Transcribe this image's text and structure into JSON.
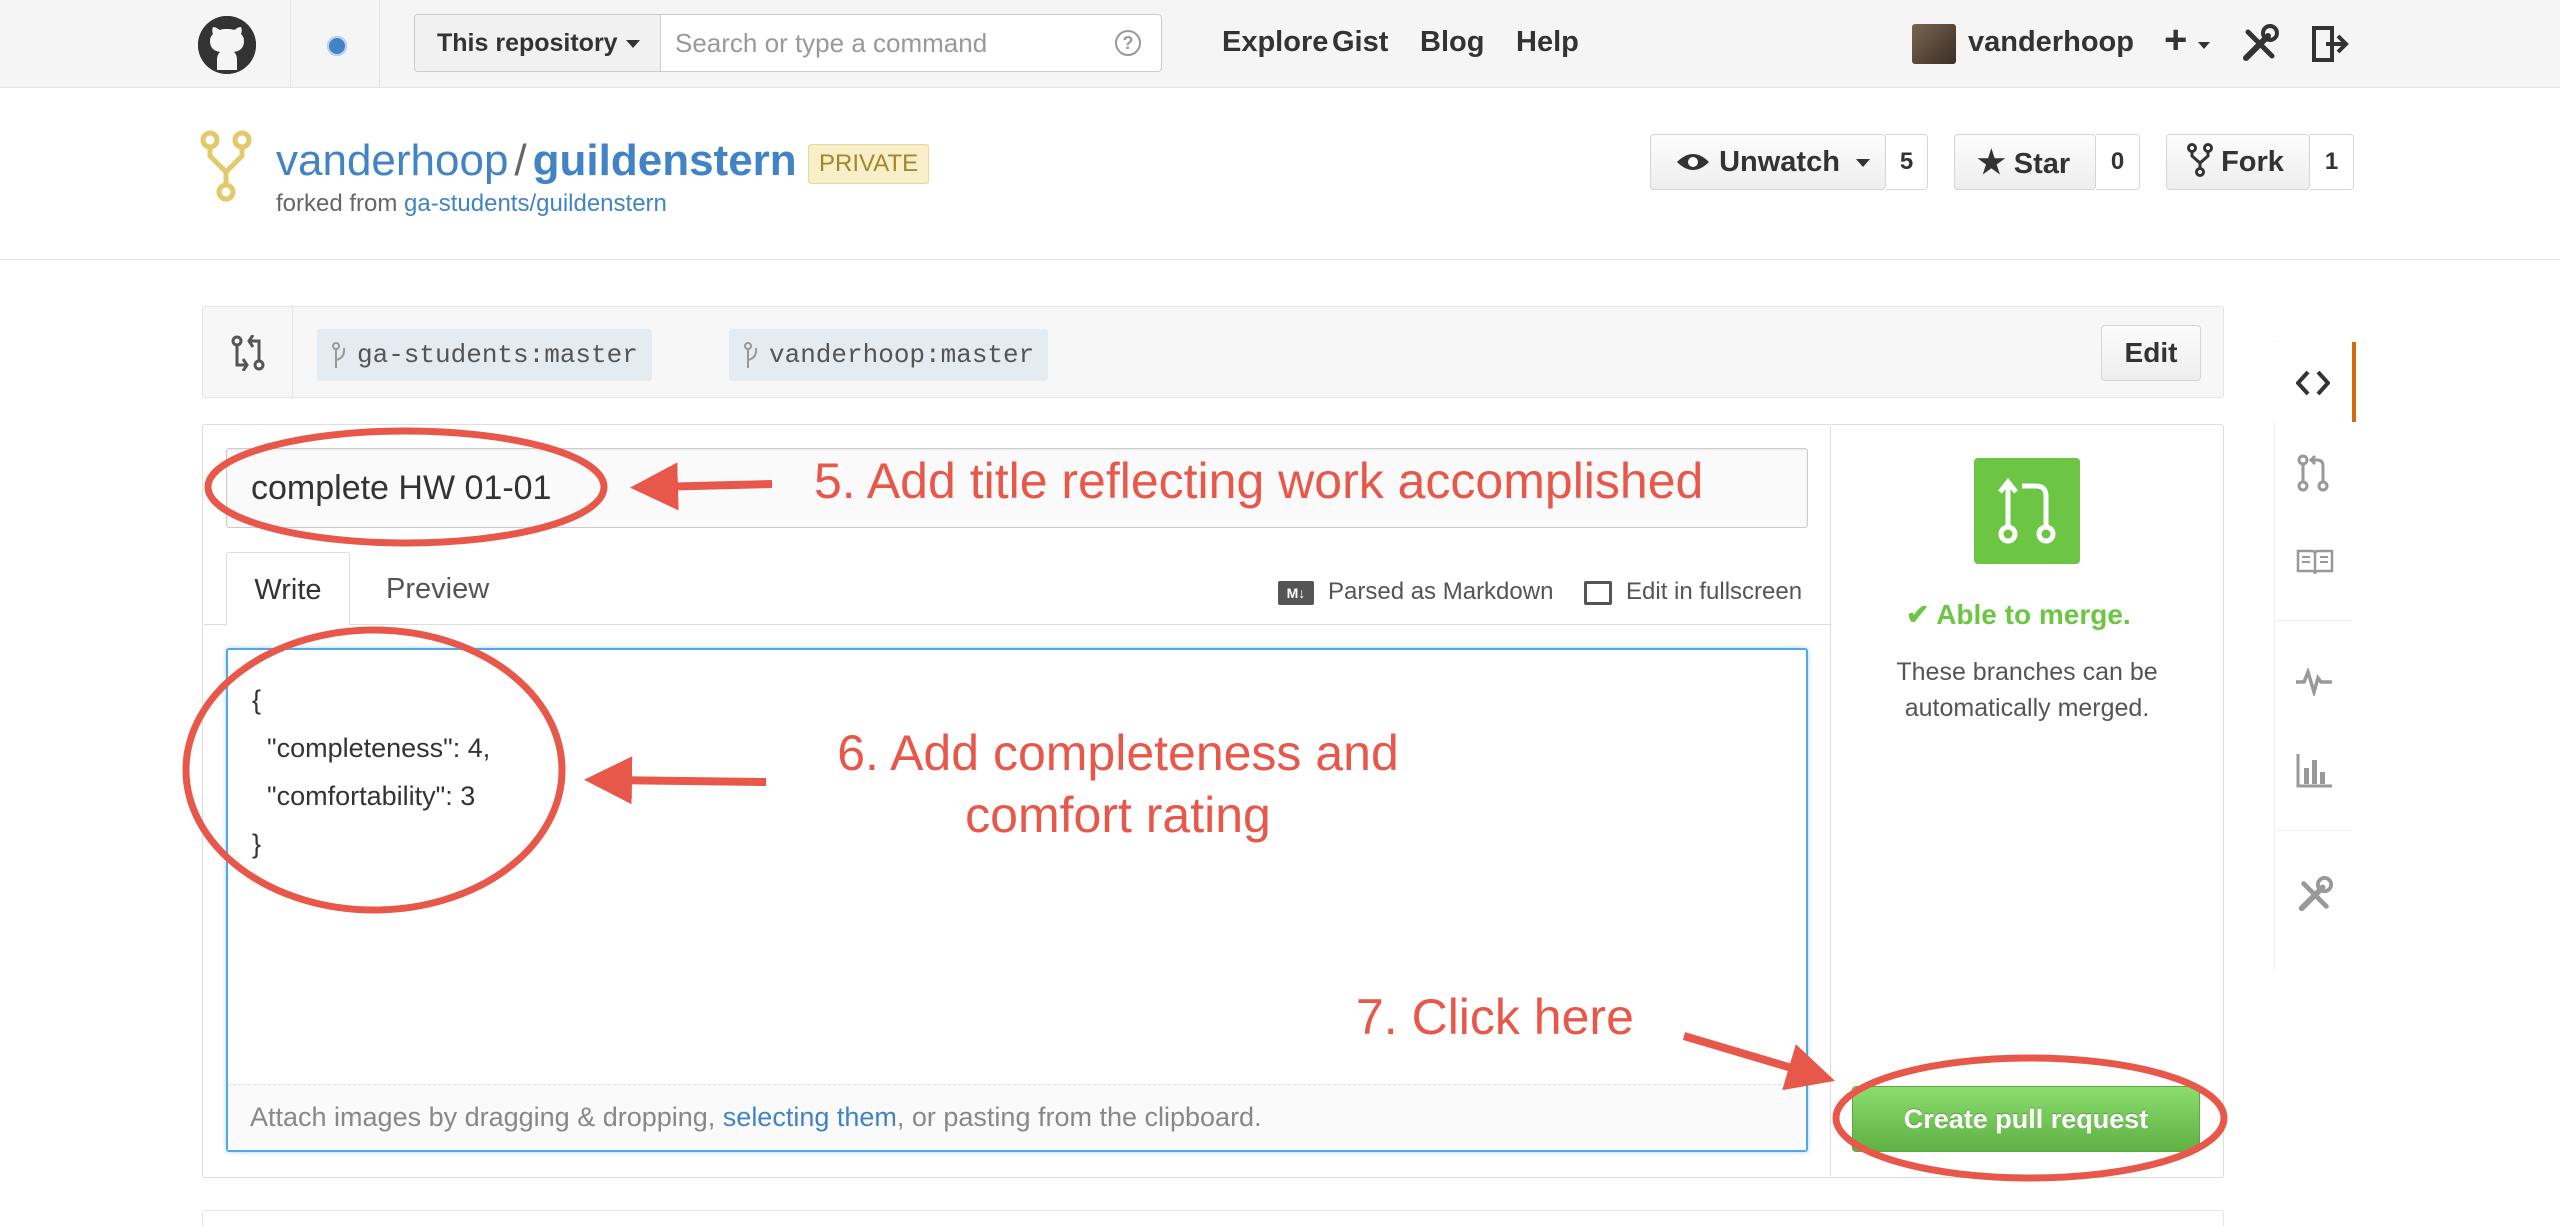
{
  "header": {
    "search_scope": "This repository",
    "search_placeholder": "Search or type a command",
    "help_glyph": "?",
    "nav": [
      "Explore",
      "Gist",
      "Blog",
      "Help"
    ],
    "username": "vanderhoop",
    "plus_glyph": "+"
  },
  "repo": {
    "owner": "vanderhoop",
    "separator": "/",
    "name": "guildenstern",
    "visibility": "PRIVATE",
    "forked_from_prefix": "forked from",
    "forked_from_link": "ga-students/guildenstern",
    "unwatch_label": "Unwatch",
    "unwatch_count": "5",
    "star_label": "Star",
    "star_count": "0",
    "fork_label": "Fork",
    "fork_count": "1"
  },
  "compare": {
    "base_branch": "ga-students:master",
    "ellipsis": "...",
    "head_branch": "vanderhoop:master",
    "edit_label": "Edit"
  },
  "form": {
    "title_value": "complete HW 01-01",
    "tab_write": "Write",
    "tab_preview": "Preview",
    "markdown_note": "Parsed as Markdown",
    "markdown_badge": "M↓",
    "fullscreen_note": "Edit in fullscreen",
    "body_value": "{\n  \"completeness\": 4,\n  \"comfortability\": 3\n}",
    "attach_prefix": "Attach images by dragging & dropping, ",
    "attach_link": "selecting them",
    "attach_suffix": ", or pasting from the clipboard."
  },
  "merge": {
    "status": "✔ Able to merge.",
    "description": "These branches can be automatically merged.",
    "create_button": "Create pull request"
  },
  "annotations": {
    "step5": "5. Add title reflecting work accomplished",
    "step6_line1": "6. Add completeness and",
    "step6_line2": "comfort rating",
    "step7": "7. Click here"
  },
  "colors": {
    "link": "#4183c4",
    "merge_green": "#6cc644",
    "annotation_red": "#e8584a",
    "sidebar_active": "#d26911"
  }
}
